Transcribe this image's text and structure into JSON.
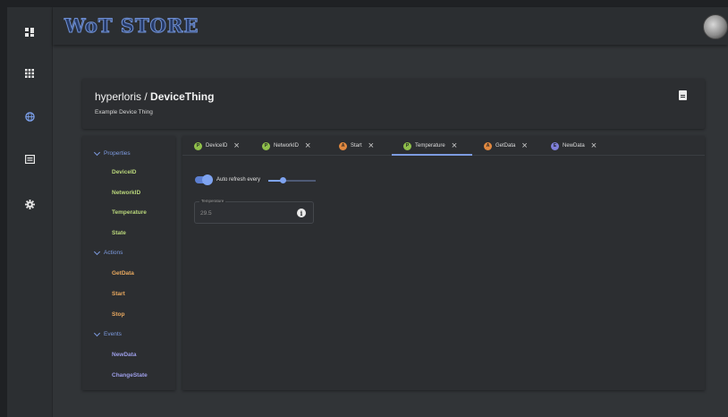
{
  "app": {
    "title": "WoT STORE"
  },
  "rail": {
    "items": [
      {
        "icon": "dashboard-icon"
      },
      {
        "icon": "apps-grid-icon"
      },
      {
        "icon": "globe-icon"
      },
      {
        "icon": "preview-icon"
      },
      {
        "icon": "gear-icon"
      }
    ]
  },
  "header": {
    "owner": "hyperloris",
    "separator": " / ",
    "thing": "DeviceThing",
    "description": "Example Device Thing",
    "action_icon": "document-icon"
  },
  "nav": {
    "groups": [
      {
        "label": "Properties",
        "items": [
          "DeviceID",
          "NetworkID",
          "Temperature",
          "State"
        ]
      },
      {
        "label": "Actions",
        "items": [
          "GetData",
          "Start",
          "Stop"
        ]
      },
      {
        "label": "Events",
        "items": [
          "NewData",
          "ChangeState"
        ]
      }
    ]
  },
  "tabs": [
    {
      "badge": "P",
      "label": "DeviceID",
      "kind": "property"
    },
    {
      "badge": "P",
      "label": "NetworkID",
      "kind": "property"
    },
    {
      "badge": "A",
      "label": "Start",
      "kind": "action"
    },
    {
      "badge": "P",
      "label": "Temperature",
      "kind": "property",
      "active": true
    },
    {
      "badge": "A",
      "label": "GetData",
      "kind": "action"
    },
    {
      "badge": "E",
      "label": "NewData",
      "kind": "event"
    }
  ],
  "panel": {
    "auto_refresh_label": "Auto refresh every",
    "auto_refresh_on": true,
    "refresh_slider_level": 0.3,
    "field_label": "Temperature",
    "field_value": "29.5",
    "info_glyph": "i"
  },
  "colors": {
    "accent": "#7d9be0",
    "property": "#b9d67b",
    "action": "#e8a85f",
    "event": "#9d9ee8"
  }
}
